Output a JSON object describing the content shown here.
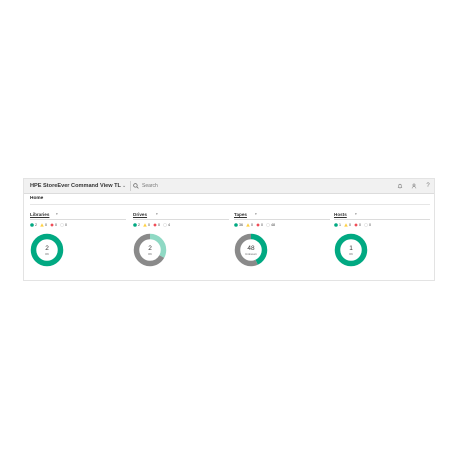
{
  "colors": {
    "ok": "#01a982",
    "warning": "#ffd144",
    "critical": "#f04953",
    "unknown": "#cccccc",
    "gray": "#8a8a8a",
    "light_green": "#8fd9c4"
  },
  "header": {
    "app_title": "HPE StoreEver Command View TL",
    "search_placeholder": "Search",
    "icons": [
      "chevron-down-icon",
      "search-icon",
      "bell-icon",
      "user-icon",
      "help-icon"
    ]
  },
  "breadcrumb": {
    "home": "Home"
  },
  "panels": [
    {
      "title": "Libraries",
      "status": {
        "ok": "2",
        "warning": "0",
        "critical": "0",
        "unknown": "0"
      },
      "center_value": "2",
      "center_label": "OK",
      "segments": [
        {
          "color": "ok",
          "fraction": 1.0
        }
      ]
    },
    {
      "title": "Drives",
      "status": {
        "ok": "2",
        "warning": "0",
        "critical": "0",
        "unknown": "4"
      },
      "center_value": "2",
      "center_label": "OK",
      "segments": [
        {
          "color": "light_green",
          "fraction": 0.33
        },
        {
          "color": "gray",
          "fraction": 0.67
        }
      ]
    },
    {
      "title": "Tapes",
      "status": {
        "ok": "36",
        "warning": "0",
        "critical": "0",
        "unknown": "48"
      },
      "center_value": "48",
      "center_label": "Unknown",
      "segments": [
        {
          "color": "ok",
          "fraction": 0.43
        },
        {
          "color": "gray",
          "fraction": 0.57
        }
      ]
    },
    {
      "title": "Hosts",
      "status": {
        "ok": "1",
        "warning": "0",
        "critical": "0",
        "unknown": "0"
      },
      "center_value": "1",
      "center_label": "OK",
      "segments": [
        {
          "color": "ok",
          "fraction": 1.0
        }
      ]
    }
  ]
}
